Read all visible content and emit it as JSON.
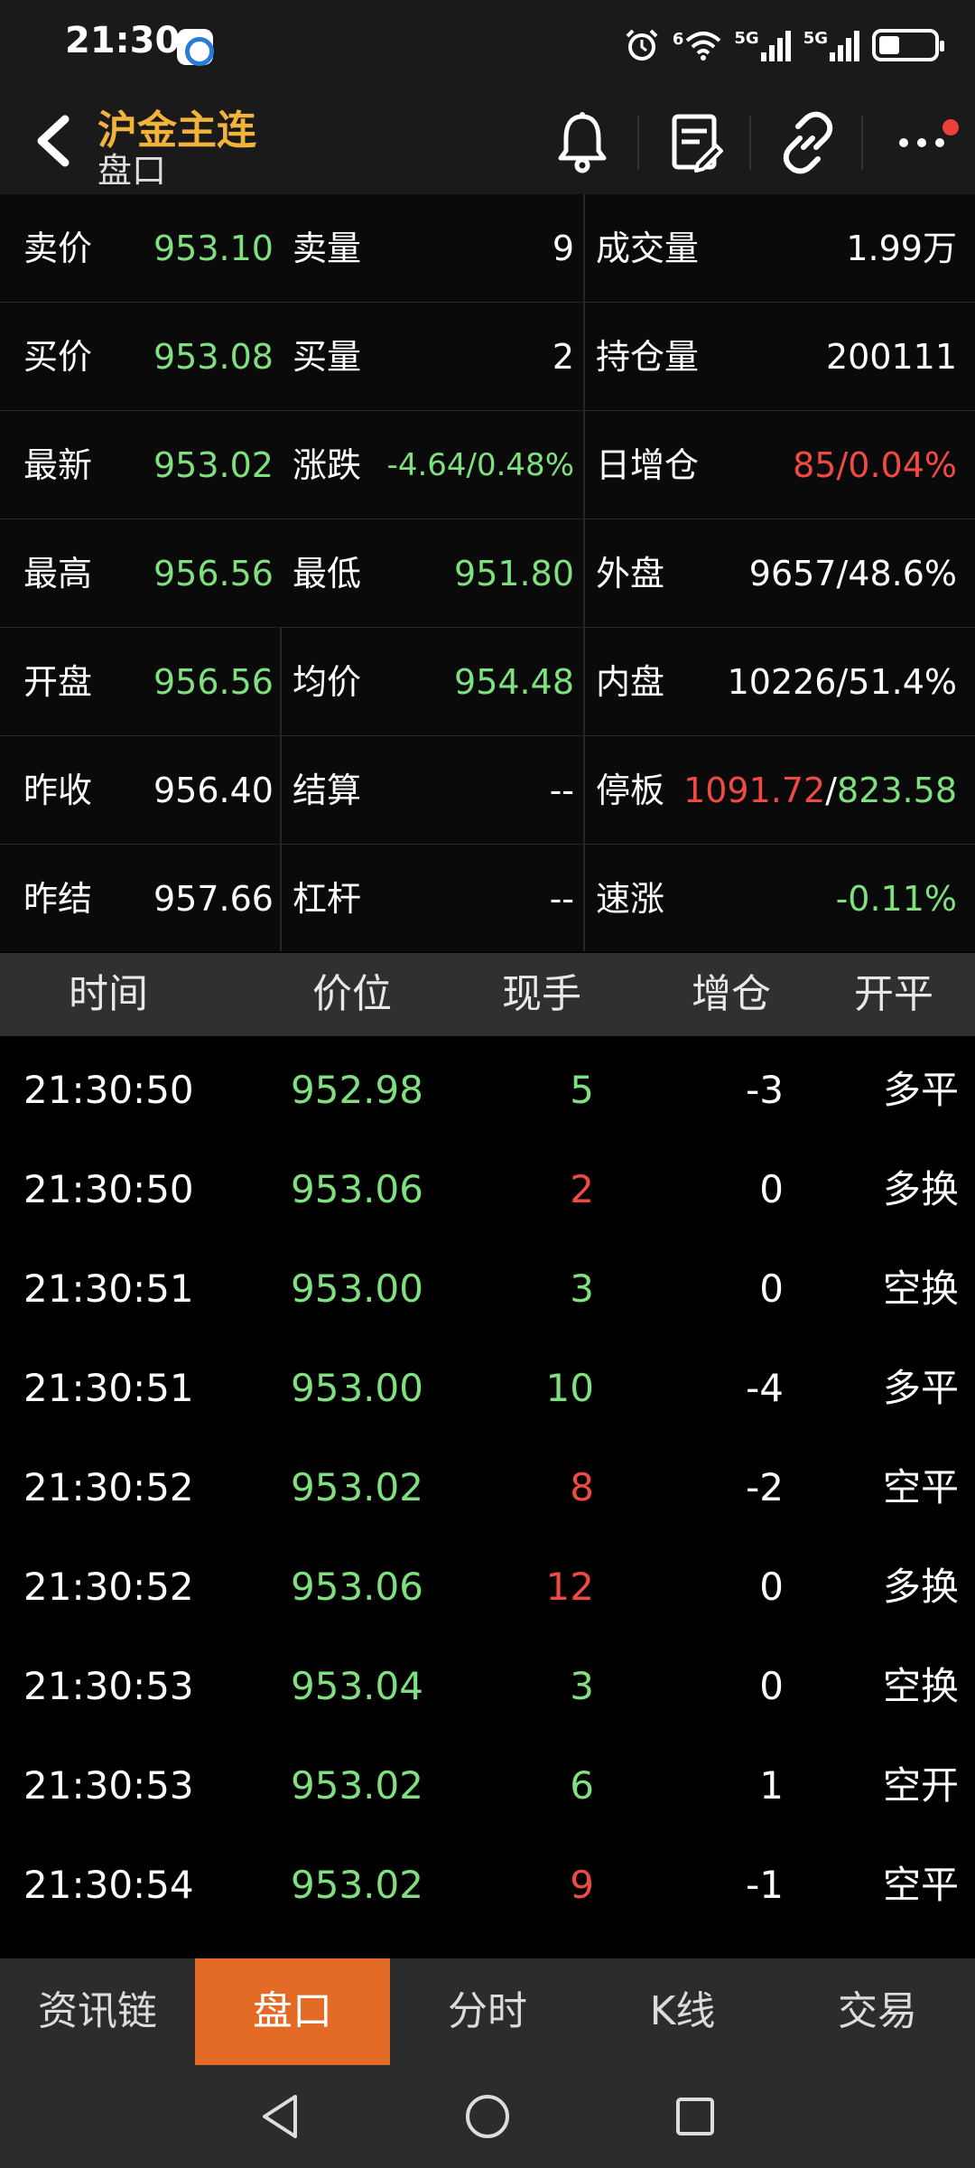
{
  "status_bar": {
    "time": "21:30",
    "wifi_label": "6",
    "sim1_label": "5G",
    "sim2_label": "5G"
  },
  "header": {
    "title": "沪金主连",
    "subtitle": "盘口",
    "accent_color": "#f2b33d"
  },
  "quotes": {
    "rows": [
      {
        "l_label": "卖价",
        "l_value": "953.10",
        "m_label": "卖量",
        "m_value": "9",
        "r_label": "成交量",
        "r_value": "1.99万"
      },
      {
        "l_label": "买价",
        "l_value": "953.08",
        "m_label": "买量",
        "m_value": "2",
        "r_label": "持仓量",
        "r_value": "200111"
      },
      {
        "l_label": "最新",
        "l_value": "953.02",
        "m_label": "涨跌",
        "m_value": "-4.64/0.48%",
        "r_label": "日增仓",
        "r_value": "85/0.04%"
      },
      {
        "l_label": "最高",
        "l_value": "956.56",
        "m_label": "最低",
        "m_value": "951.80",
        "r_label": "外盘",
        "r_value": "9657/48.6%"
      },
      {
        "l_label": "开盘",
        "l_value": "956.56",
        "m_label": "均价",
        "m_value": "954.48",
        "r_label": "内盘",
        "r_value": "10226/51.4%"
      },
      {
        "l_label": "昨收",
        "l_value": "956.40",
        "m_label": "结算",
        "m_value": "--",
        "r_label": "停板",
        "r_value_up": "1091.72",
        "r_value_sep": "/",
        "r_value_down": "823.58"
      },
      {
        "l_label": "昨结",
        "l_value": "957.66",
        "m_label": "杠杆",
        "m_value": "--",
        "r_label": "速涨",
        "r_value": "-0.11%"
      }
    ]
  },
  "ticks": {
    "headers": [
      "时间",
      "价位",
      "现手",
      "增仓",
      "开平"
    ],
    "rows": [
      {
        "time": "21:30:50",
        "price": "952.98",
        "vol": "5",
        "oi": "-3",
        "type": "多平"
      },
      {
        "time": "21:30:50",
        "price": "953.06",
        "vol": "2",
        "oi": "0",
        "type": "多换"
      },
      {
        "time": "21:30:51",
        "price": "953.00",
        "vol": "3",
        "oi": "0",
        "type": "空换"
      },
      {
        "time": "21:30:51",
        "price": "953.00",
        "vol": "10",
        "oi": "-4",
        "type": "多平"
      },
      {
        "time": "21:30:52",
        "price": "953.02",
        "vol": "8",
        "oi": "-2",
        "type": "空平"
      },
      {
        "time": "21:30:52",
        "price": "953.06",
        "vol": "12",
        "oi": "0",
        "type": "多换"
      },
      {
        "time": "21:30:53",
        "price": "953.04",
        "vol": "3",
        "oi": "0",
        "type": "空换"
      },
      {
        "time": "21:30:53",
        "price": "953.02",
        "vol": "6",
        "oi": "1",
        "type": "空开"
      },
      {
        "time": "21:30:54",
        "price": "953.02",
        "vol": "9",
        "oi": "-1",
        "type": "空平"
      }
    ]
  },
  "tabs": [
    {
      "label": "资讯链",
      "active": false
    },
    {
      "label": "盘口",
      "active": true
    },
    {
      "label": "分时",
      "active": false
    },
    {
      "label": "K线",
      "active": false
    },
    {
      "label": "交易",
      "active": false
    }
  ],
  "colors": {
    "up": "#f04a44",
    "down": "#7ee07e",
    "active_tab": "#e36b26"
  }
}
